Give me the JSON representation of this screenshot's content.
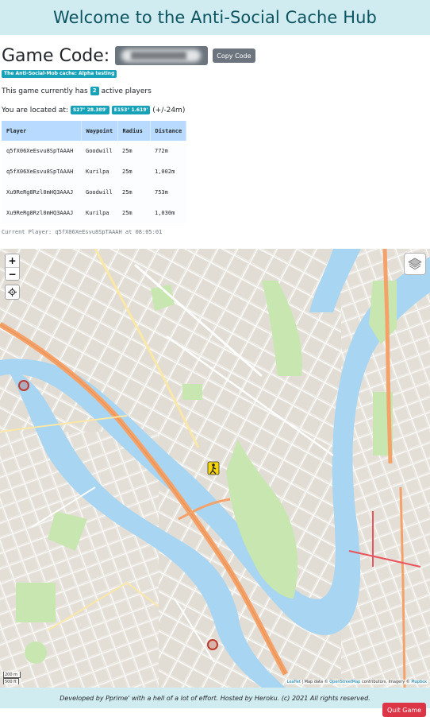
{
  "header": {
    "title": "Welcome to the Anti-Social Cache Hub"
  },
  "game": {
    "code_label": "Game Code:",
    "copy_label": "Copy Code",
    "cache_badge": "The Anti-Social-Mob cache: Alpha testing"
  },
  "status": {
    "players_prefix": "This game currently has",
    "players_count": "2",
    "players_suffix": "active players",
    "location_prefix": "You are located at:",
    "lat": "S27° 28.389'",
    "lon": "E153° 1.619'",
    "accuracy": "(+/-24m)"
  },
  "table": {
    "headers": [
      "Player",
      "Waypoint",
      "Radius",
      "Distance"
    ],
    "rows": [
      [
        "q5fX06XeEsvu8SpTAAAH",
        "Goodwill",
        "25m",
        "772m"
      ],
      [
        "q5fX06XeEsvu8SpTAAAH",
        "Kurilpa",
        "25m",
        "1,002m"
      ],
      [
        "Xu9ReRg8Rzl0mHQ3AAAJ",
        "Goodwill",
        "25m",
        "753m"
      ],
      [
        "Xu9ReRg8Rzl0mHQ3AAAJ",
        "Kurilpa",
        "25m",
        "1,030m"
      ]
    ]
  },
  "current_player": "Current Player: q5fX06XeEsvu8SpTAAAH at 08:05:01",
  "map": {
    "zoom_in": "+",
    "zoom_out": "−",
    "scale_metric": "200 m",
    "scale_imperial": "500 ft",
    "attribution_leaflet": "Leaflet",
    "attribution_mid": "| Map data ©",
    "attribution_osm": "OpenStreetMap",
    "attribution_rest": "contributors, Imagery ©",
    "attribution_mapbox": "Mapbox",
    "icons": [
      "locate-icon",
      "layers-icon",
      "hiker-marker-icon",
      "waypoint-circle-icon"
    ],
    "colors": {
      "water": "#a8d5f2",
      "park": "#c8e6b0",
      "motorway": "#f4a26a",
      "waypoint": "#c0392b"
    }
  },
  "footer": {
    "text": "Developed by Pprime' with a hell of a lot of effort. Hosted by Heroku. (c) 2021 All rights reserved.",
    "quit_label": "Quit Game"
  }
}
